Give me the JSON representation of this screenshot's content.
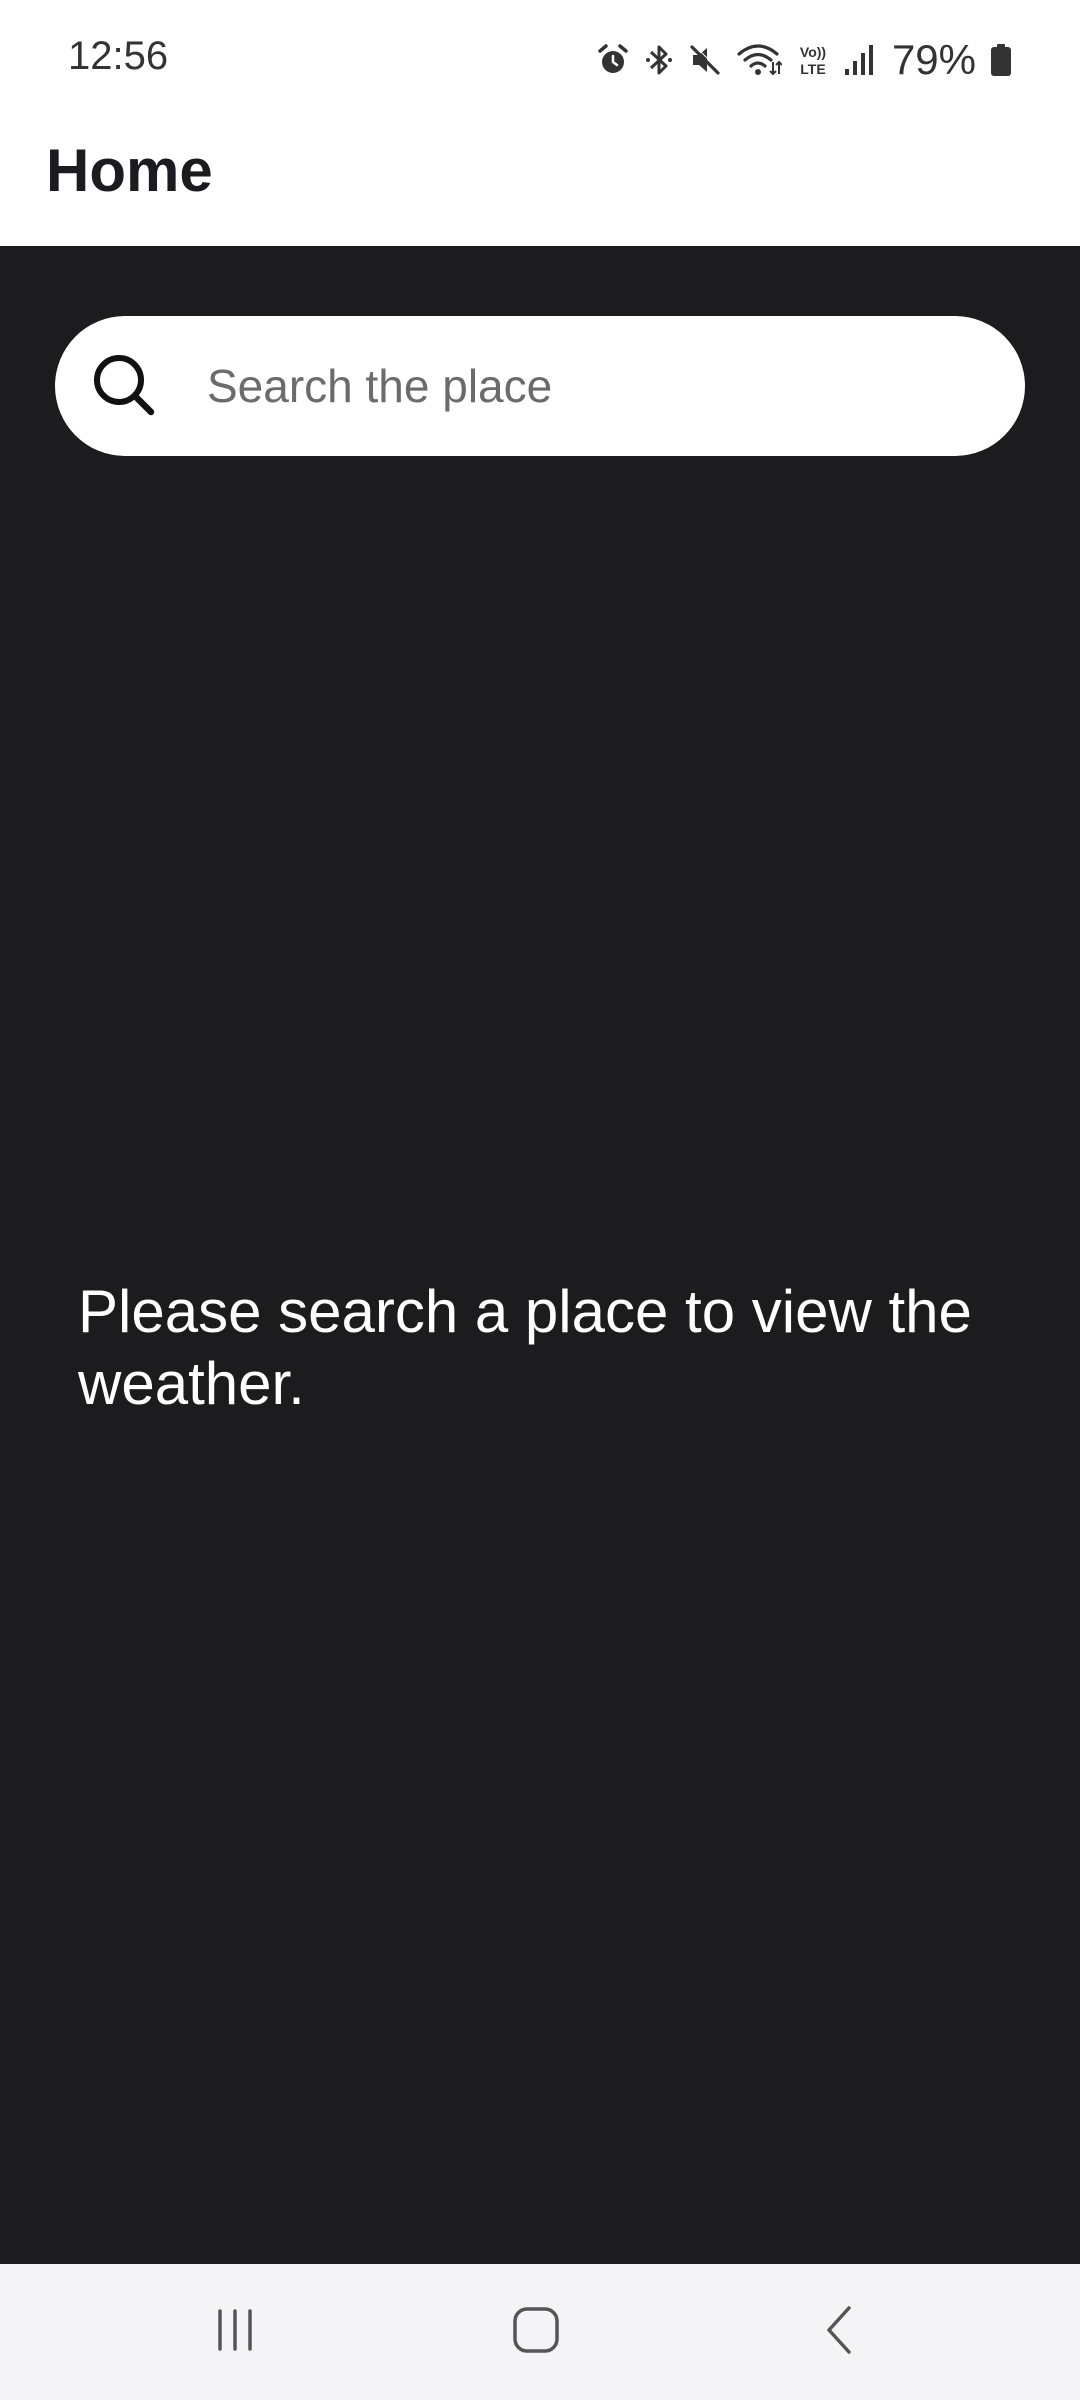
{
  "status_bar": {
    "time": "12:56",
    "battery_percent": "79%",
    "network_label_top": "Vo))",
    "network_label_bottom": "LTE",
    "icons": [
      "alarm-icon",
      "bluetooth-icon",
      "mute-icon",
      "wifi-icon",
      "volte-icon",
      "signal-icon",
      "battery-icon"
    ]
  },
  "app_bar": {
    "title": "Home"
  },
  "search": {
    "placeholder": "Search the place",
    "value": "",
    "icon": "search-icon"
  },
  "main": {
    "empty_message": "Please search a place to view the weather."
  },
  "nav_bar": {
    "buttons": [
      "recents-icon",
      "home-icon",
      "back-icon"
    ]
  },
  "colors": {
    "content_background": "#1c1b1d",
    "app_bar_background": "#ffffff",
    "nav_bar_background": "#f4f4f6",
    "message_text": "#ffffff"
  }
}
